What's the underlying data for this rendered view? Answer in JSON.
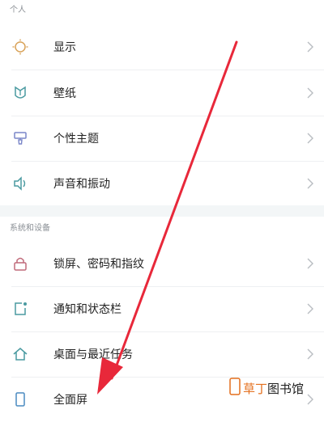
{
  "sections": [
    {
      "title": "个人",
      "items": [
        {
          "label": "显示",
          "icon": "sun-icon"
        },
        {
          "label": "壁纸",
          "icon": "wallpaper-icon"
        },
        {
          "label": "个性主题",
          "icon": "theme-brush-icon"
        },
        {
          "label": "声音和振动",
          "icon": "speaker-icon"
        }
      ]
    },
    {
      "title": "系统和设备",
      "items": [
        {
          "label": "锁屏、密码和指纹",
          "icon": "lock-icon"
        },
        {
          "label": "通知和状态栏",
          "icon": "notification-icon"
        },
        {
          "label": "桌面与最近任务",
          "icon": "home-icon"
        },
        {
          "label": "全面屏",
          "icon": "phone-fullscreen-icon"
        }
      ]
    }
  ],
  "watermark": {
    "text_a": "草丁",
    "text_b": "图书馆"
  },
  "colors": {
    "accent_icon": "#d9a35a",
    "teal_icon": "#4a9aa0",
    "arrow": "#e8283a"
  }
}
